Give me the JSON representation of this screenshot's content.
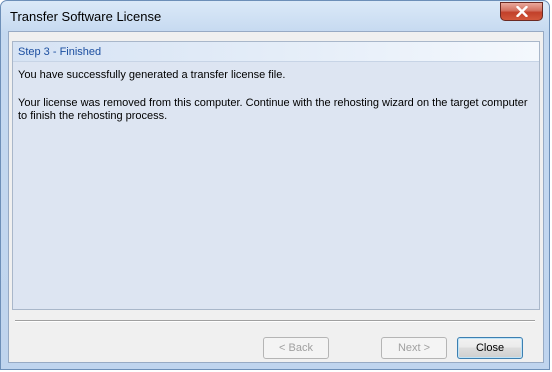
{
  "window": {
    "title": "Transfer Software License"
  },
  "panel": {
    "step_title": "Step 3 - Finished",
    "message_success": "You have successfully generated a transfer license file.",
    "message_detail": "Your license was removed from this computer. Continue with the rehosting wizard on the target computer to finish the rehosting process."
  },
  "buttons": {
    "back_label": "< Back",
    "next_label": "Next >",
    "close_label": "Close"
  },
  "icons": {
    "title_close": "close-icon"
  },
  "colors": {
    "close_button": "#c2402a",
    "step_title": "#1c4fa0",
    "panel_background": "#dde5f2"
  }
}
